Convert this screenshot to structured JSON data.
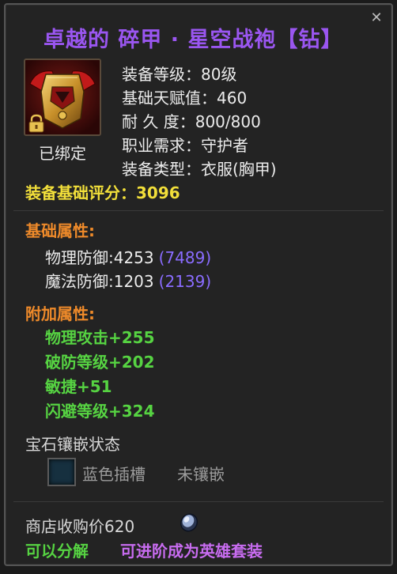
{
  "item": {
    "title": "卓越的 碎甲 · 星空战袍【钻】",
    "bound": "已绑定",
    "close_symbol": "✕",
    "icon": "armor-chestplate-icon",
    "lock_icon": "lock-icon"
  },
  "stats": [
    {
      "label": "装备等级：",
      "value": "80级"
    },
    {
      "label": "基础天赋值：",
      "value": "460"
    },
    {
      "label": "耐 久 度：",
      "value": "800/800"
    },
    {
      "label": "职业需求：",
      "value": "守护者"
    },
    {
      "label": "装备类型：",
      "value": "衣服(胸甲)"
    }
  ],
  "score": {
    "label": "装备基础评分：",
    "value": "3096"
  },
  "base_attributes": {
    "heading": "基础属性:",
    "items": [
      {
        "label": "物理防御:4253",
        "extra": "(7489)"
      },
      {
        "label": "魔法防御:1203",
        "extra": "(2139)"
      }
    ]
  },
  "bonus_attributes": {
    "heading": "附加属性:",
    "items": [
      {
        "label": "物理攻击+255"
      },
      {
        "label": "破防等级+202"
      },
      {
        "label": "敏捷+51"
      },
      {
        "label": "闪避等级+324"
      }
    ]
  },
  "gems": {
    "heading": "宝石镶嵌状态",
    "slots": [
      {
        "label": "蓝色插槽",
        "status": "未镶嵌"
      }
    ]
  },
  "footer": {
    "shop_price": "商店收购价620",
    "coin_icon": "silver-coin-icon",
    "can_decompose": "可以分解",
    "can_upgrade": "可进阶成为英雄套装"
  },
  "colors": {
    "title": "#9a56f0",
    "score": "#f2df3a",
    "section_heading": "#ee8a2a",
    "bonus": "#56d342",
    "extra": "#8a6cff",
    "upgrade": "#c86cf0"
  }
}
